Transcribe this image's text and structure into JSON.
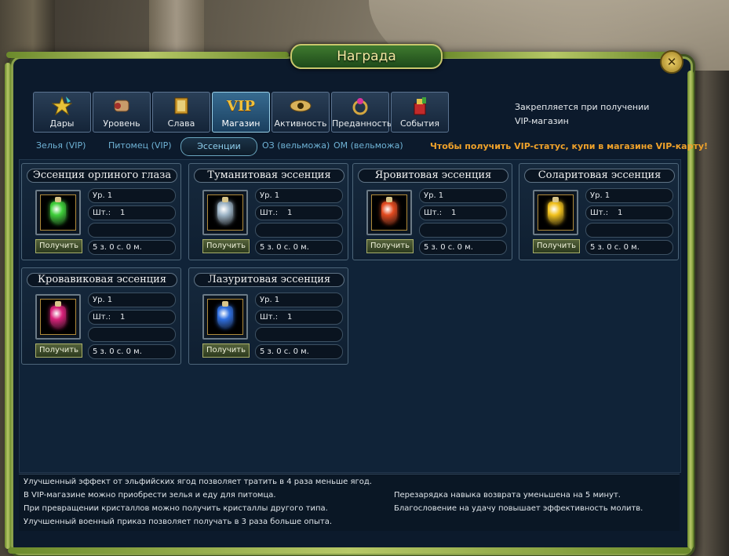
{
  "window": {
    "title": "Награда",
    "close_glyph": "✕"
  },
  "tabs": [
    {
      "label": "Дары",
      "icon": "star-icon"
    },
    {
      "label": "Уровень",
      "icon": "scroll-icon"
    },
    {
      "label": "Слава",
      "icon": "book-icon"
    },
    {
      "label": "Магазин",
      "icon": "vip-icon",
      "icon_text": "VIP",
      "active": true
    },
    {
      "label": "Активность",
      "icon": "eye-icon"
    },
    {
      "label": "Преданность",
      "icon": "ring-icon"
    },
    {
      "label": "События",
      "icon": "gift-bag-icon"
    }
  ],
  "pin_note": {
    "line1": "Закрепляется при получении",
    "line2": "VIP-магазин"
  },
  "subtabs": [
    {
      "label": "Зелья (VIP)"
    },
    {
      "label": "Питомец (VIP)"
    },
    {
      "label": "Эссенции",
      "active": true
    },
    {
      "label": "ОЗ (вельможа)"
    },
    {
      "label": "ОМ (вельможа)"
    }
  ],
  "vip_hint": "Чтобы получить VIP-статус, купи в магазине VIP-карту!",
  "item_labels": {
    "level": "Ур. 1",
    "qty_label": "Шт.:",
    "qty_value": "1",
    "price": "5 з. 0 с. 0 м.",
    "get_button": "Получить"
  },
  "items": [
    {
      "name": "Эссенция орлиного глаза",
      "color": "#3fcf3a"
    },
    {
      "name": "Туманитовая эссенция",
      "color": "#9fb6c8"
    },
    {
      "name": "Яровитовая эссенция",
      "color": "#e24a1f"
    },
    {
      "name": "Соларитовая эссенция",
      "color": "#f2c21d"
    },
    {
      "name": "Кровавиковая эссенция",
      "color": "#d8217a"
    },
    {
      "name": "Лазуритовая эссенция",
      "color": "#2f6fe0"
    }
  ],
  "info": {
    "left": [
      "Улучшенный эффект от эльфийских ягод позволяет тратить в 4 раза меньше ягод.",
      "В VIP-магазине можно приобрести зелья и еду для питомца.",
      "При превращении кристаллов можно получить кристаллы другого типа.",
      "Улучшенный военный приказ позволяет получать в 3 раза больше опыта."
    ],
    "right": [
      "Перезарядка навыка возврата уменьшена на 5 минут.",
      "Благословение на удачу повышает эффективность молитв."
    ]
  }
}
